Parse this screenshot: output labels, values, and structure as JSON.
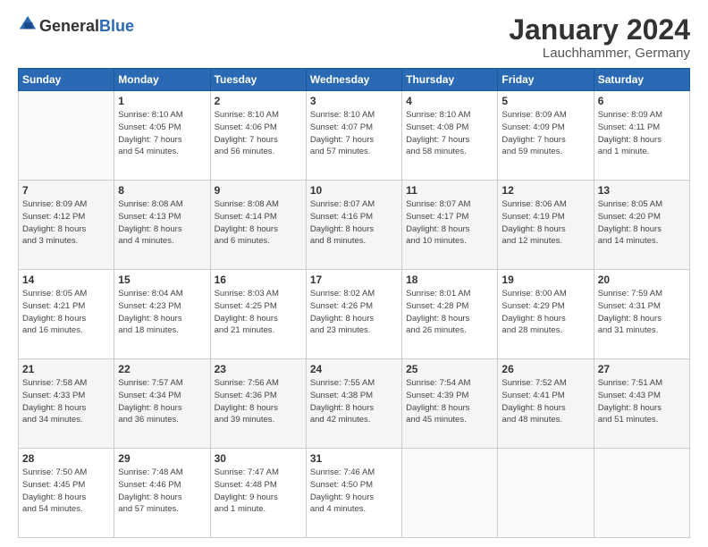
{
  "logo": {
    "general": "General",
    "blue": "Blue"
  },
  "header": {
    "title": "January 2024",
    "subtitle": "Lauchhammer, Germany"
  },
  "days_of_week": [
    "Sunday",
    "Monday",
    "Tuesday",
    "Wednesday",
    "Thursday",
    "Friday",
    "Saturday"
  ],
  "weeks": [
    [
      {
        "day": "",
        "info": ""
      },
      {
        "day": "1",
        "info": "Sunrise: 8:10 AM\nSunset: 4:05 PM\nDaylight: 7 hours\nand 54 minutes."
      },
      {
        "day": "2",
        "info": "Sunrise: 8:10 AM\nSunset: 4:06 PM\nDaylight: 7 hours\nand 56 minutes."
      },
      {
        "day": "3",
        "info": "Sunrise: 8:10 AM\nSunset: 4:07 PM\nDaylight: 7 hours\nand 57 minutes."
      },
      {
        "day": "4",
        "info": "Sunrise: 8:10 AM\nSunset: 4:08 PM\nDaylight: 7 hours\nand 58 minutes."
      },
      {
        "day": "5",
        "info": "Sunrise: 8:09 AM\nSunset: 4:09 PM\nDaylight: 7 hours\nand 59 minutes."
      },
      {
        "day": "6",
        "info": "Sunrise: 8:09 AM\nSunset: 4:11 PM\nDaylight: 8 hours\nand 1 minute."
      }
    ],
    [
      {
        "day": "7",
        "info": "Sunrise: 8:09 AM\nSunset: 4:12 PM\nDaylight: 8 hours\nand 3 minutes."
      },
      {
        "day": "8",
        "info": "Sunrise: 8:08 AM\nSunset: 4:13 PM\nDaylight: 8 hours\nand 4 minutes."
      },
      {
        "day": "9",
        "info": "Sunrise: 8:08 AM\nSunset: 4:14 PM\nDaylight: 8 hours\nand 6 minutes."
      },
      {
        "day": "10",
        "info": "Sunrise: 8:07 AM\nSunset: 4:16 PM\nDaylight: 8 hours\nand 8 minutes."
      },
      {
        "day": "11",
        "info": "Sunrise: 8:07 AM\nSunset: 4:17 PM\nDaylight: 8 hours\nand 10 minutes."
      },
      {
        "day": "12",
        "info": "Sunrise: 8:06 AM\nSunset: 4:19 PM\nDaylight: 8 hours\nand 12 minutes."
      },
      {
        "day": "13",
        "info": "Sunrise: 8:05 AM\nSunset: 4:20 PM\nDaylight: 8 hours\nand 14 minutes."
      }
    ],
    [
      {
        "day": "14",
        "info": "Sunrise: 8:05 AM\nSunset: 4:21 PM\nDaylight: 8 hours\nand 16 minutes."
      },
      {
        "day": "15",
        "info": "Sunrise: 8:04 AM\nSunset: 4:23 PM\nDaylight: 8 hours\nand 18 minutes."
      },
      {
        "day": "16",
        "info": "Sunrise: 8:03 AM\nSunset: 4:25 PM\nDaylight: 8 hours\nand 21 minutes."
      },
      {
        "day": "17",
        "info": "Sunrise: 8:02 AM\nSunset: 4:26 PM\nDaylight: 8 hours\nand 23 minutes."
      },
      {
        "day": "18",
        "info": "Sunrise: 8:01 AM\nSunset: 4:28 PM\nDaylight: 8 hours\nand 26 minutes."
      },
      {
        "day": "19",
        "info": "Sunrise: 8:00 AM\nSunset: 4:29 PM\nDaylight: 8 hours\nand 28 minutes."
      },
      {
        "day": "20",
        "info": "Sunrise: 7:59 AM\nSunset: 4:31 PM\nDaylight: 8 hours\nand 31 minutes."
      }
    ],
    [
      {
        "day": "21",
        "info": "Sunrise: 7:58 AM\nSunset: 4:33 PM\nDaylight: 8 hours\nand 34 minutes."
      },
      {
        "day": "22",
        "info": "Sunrise: 7:57 AM\nSunset: 4:34 PM\nDaylight: 8 hours\nand 36 minutes."
      },
      {
        "day": "23",
        "info": "Sunrise: 7:56 AM\nSunset: 4:36 PM\nDaylight: 8 hours\nand 39 minutes."
      },
      {
        "day": "24",
        "info": "Sunrise: 7:55 AM\nSunset: 4:38 PM\nDaylight: 8 hours\nand 42 minutes."
      },
      {
        "day": "25",
        "info": "Sunrise: 7:54 AM\nSunset: 4:39 PM\nDaylight: 8 hours\nand 45 minutes."
      },
      {
        "day": "26",
        "info": "Sunrise: 7:52 AM\nSunset: 4:41 PM\nDaylight: 8 hours\nand 48 minutes."
      },
      {
        "day": "27",
        "info": "Sunrise: 7:51 AM\nSunset: 4:43 PM\nDaylight: 8 hours\nand 51 minutes."
      }
    ],
    [
      {
        "day": "28",
        "info": "Sunrise: 7:50 AM\nSunset: 4:45 PM\nDaylight: 8 hours\nand 54 minutes."
      },
      {
        "day": "29",
        "info": "Sunrise: 7:48 AM\nSunset: 4:46 PM\nDaylight: 8 hours\nand 57 minutes."
      },
      {
        "day": "30",
        "info": "Sunrise: 7:47 AM\nSunset: 4:48 PM\nDaylight: 9 hours\nand 1 minute."
      },
      {
        "day": "31",
        "info": "Sunrise: 7:46 AM\nSunset: 4:50 PM\nDaylight: 9 hours\nand 4 minutes."
      },
      {
        "day": "",
        "info": ""
      },
      {
        "day": "",
        "info": ""
      },
      {
        "day": "",
        "info": ""
      }
    ]
  ]
}
